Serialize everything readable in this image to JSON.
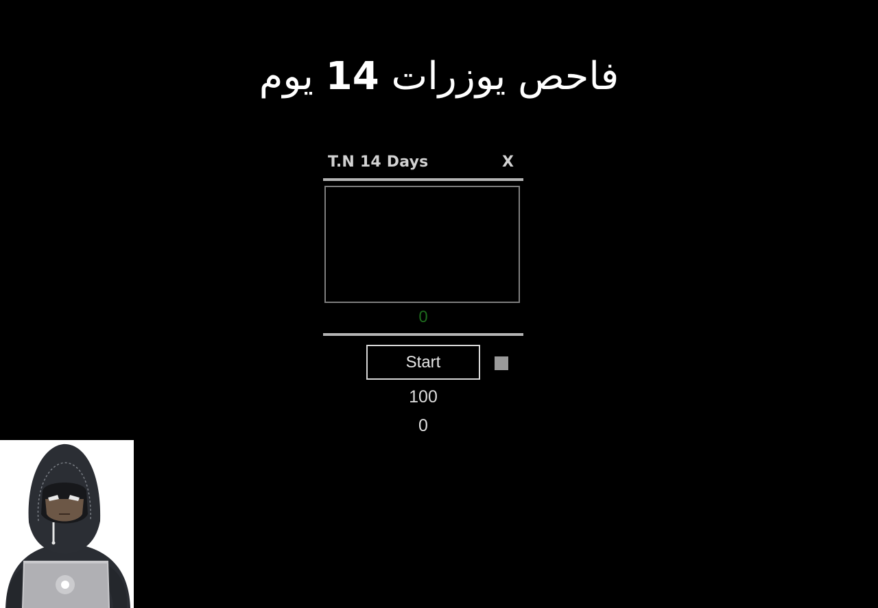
{
  "banner": {
    "title_before": "فاحص يوزرات ",
    "title_number": "14",
    "title_after": " يوم"
  },
  "app": {
    "title": "T.N 14 Days",
    "close_label": "X",
    "results_text": "",
    "found_count": "0",
    "start_label": "Start",
    "thread_count": "100",
    "checked_count": "0"
  },
  "colors": {
    "background": "#000000",
    "found_count": "#1d6a1d",
    "divider": "#b4b4b4",
    "checkbox": "#9a9a9a"
  },
  "icons": {
    "logo": "hooded-hacker-laptop-icon"
  }
}
